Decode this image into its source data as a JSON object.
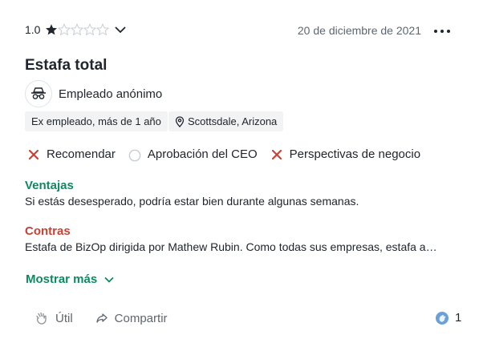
{
  "review": {
    "rating_value": "1.0",
    "rating_stars": 1,
    "rating_max": 5,
    "date": "20 de diciembre de 2021",
    "title": "Estafa total",
    "author": "Empleado anónimo",
    "employment_status": "Ex empleado, más de 1 año",
    "location": "Scottsdale, Arizona",
    "ratings": [
      {
        "label": "Recomendar",
        "state": "no",
        "icon": "x-icon"
      },
      {
        "label": "Aprobación del CEO",
        "state": "neutral",
        "icon": "circle-icon"
      },
      {
        "label": "Perspectivas de negocio",
        "state": "no",
        "icon": "x-icon"
      }
    ],
    "pros_heading": "Ventajas",
    "pros_text": "Si estás desesperado, podría estar bien durante algunas semanas.",
    "cons_heading": "Contras",
    "cons_text": "Estafa de BizOp dirigida por Mathew Rubin. Como todas sus empresas, estafa a…",
    "show_more": "Mostrar más"
  },
  "footer": {
    "helpful_label": "Útil",
    "share_label": "Compartir",
    "reaction_count": "1"
  },
  "colors": {
    "accent_green": "#0f8a5f",
    "cons_red": "#c64236",
    "x_red": "#c64236",
    "star_dark": "#20262e",
    "tag_bg": "#f1f3f5"
  }
}
